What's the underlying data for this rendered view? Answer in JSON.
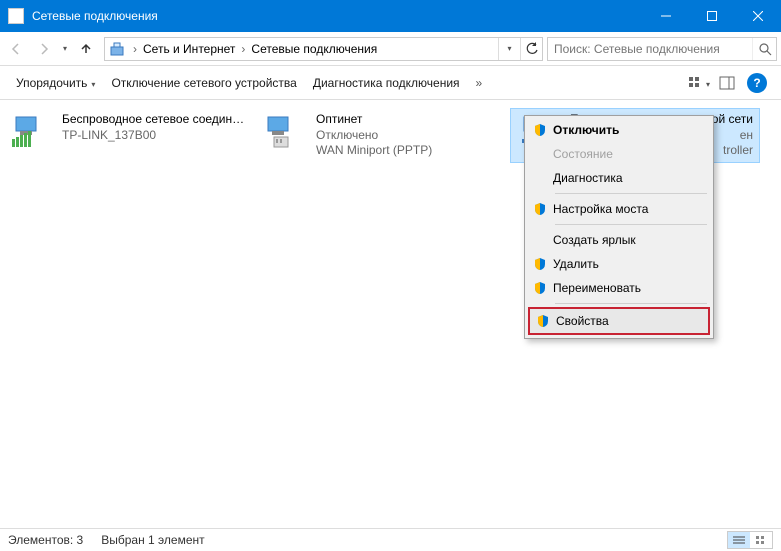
{
  "window": {
    "title": "Сетевые подключения"
  },
  "breadcrumb": {
    "item1": "Сеть и Интернет",
    "item2": "Сетевые подключения"
  },
  "search": {
    "placeholder": "Поиск: Сетевые подключения"
  },
  "commandbar": {
    "organize": "Упорядочить",
    "disable_device": "Отключение сетевого устройства",
    "diagnose": "Диагностика подключения"
  },
  "connections": [
    {
      "name": "Беспроводное сетевое соединение",
      "line2": "TP-LINK_137B00",
      "line3": ""
    },
    {
      "name": "Оптинет",
      "line2": "Отключено",
      "line3": "WAN Miniport (PPTP)"
    },
    {
      "name": "Подключение по локальной сети",
      "line2": "",
      "line3": ""
    }
  ],
  "contextmenu": {
    "items": {
      "disable": "Отключить",
      "status": "Состояние",
      "diagnose": "Диагностика",
      "bridge": "Настройка моста",
      "shortcut": "Создать ярлык",
      "delete": "Удалить",
      "rename": "Переименовать",
      "properties": "Свойства"
    }
  },
  "statusbar": {
    "elements": "Элементов: 3",
    "selected": "Выбран 1 элемент"
  },
  "hidden_text_behind_menu": {
    "status": "ен",
    "adapter_suffix": "troller"
  }
}
